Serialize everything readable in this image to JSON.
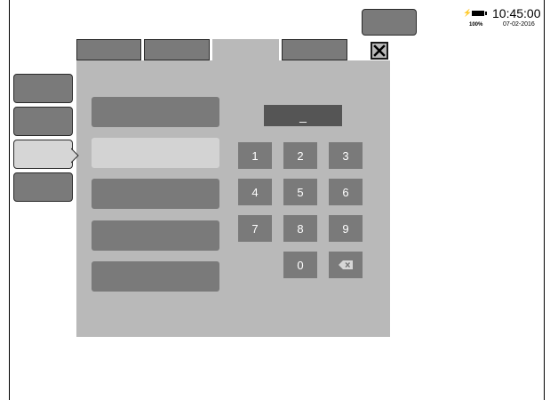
{
  "status_bar": {
    "battery_percent": "100%",
    "time": "10:45:00",
    "date": "07-02-2016",
    "icons": [
      "plug-icon",
      "battery-icon"
    ]
  },
  "keypad": {
    "display_value": "_",
    "keys": [
      "1",
      "2",
      "3",
      "4",
      "5",
      "6",
      "7",
      "8",
      "9",
      "0"
    ],
    "backspace_icon": "backspace-icon"
  },
  "close_icon": "close-icon",
  "colors": {
    "panel": "#b9b9b9",
    "button": "#7a7a7a",
    "selected": "#d3d3d3",
    "display": "#555555"
  }
}
